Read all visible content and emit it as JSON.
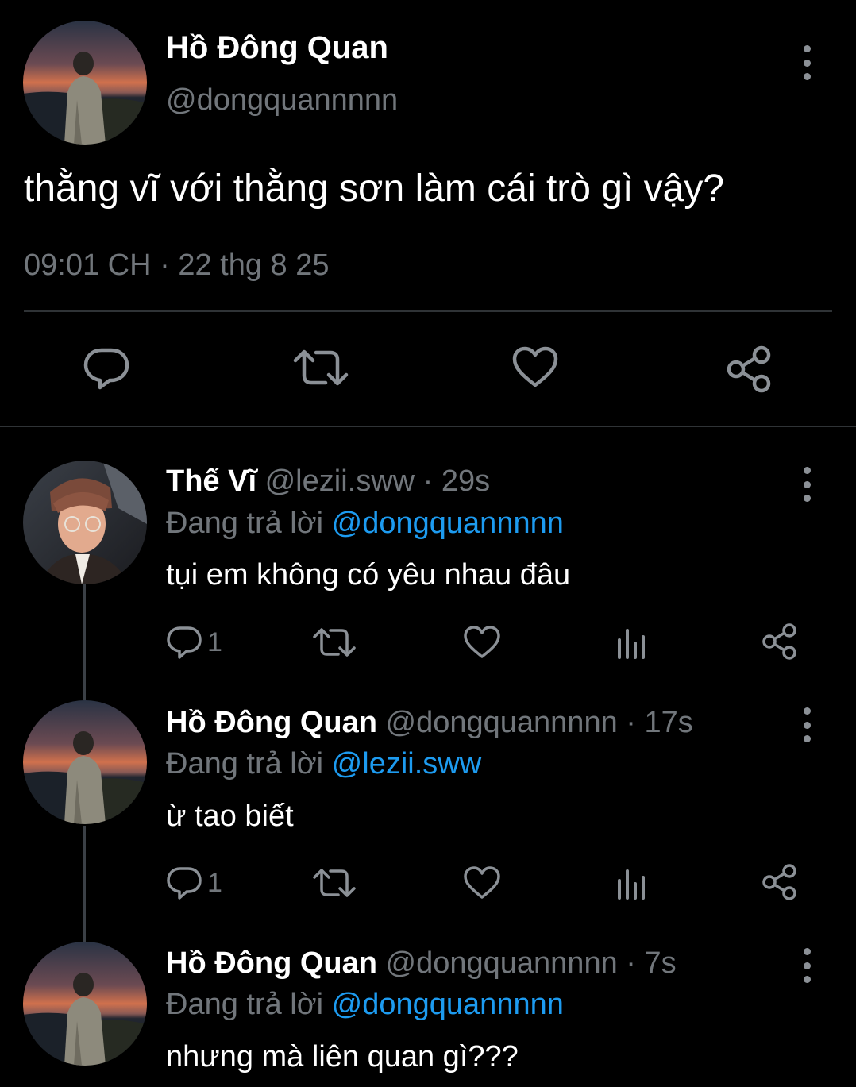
{
  "colors": {
    "background": "#000000",
    "primary_text": "#ffffff",
    "secondary_text": "#71767b",
    "mention": "#1d9bf0",
    "divider": "#2f3336"
  },
  "main_tweet": {
    "display_name": "Hồ Đông Quan",
    "handle": "@dongquannnnn",
    "text": "thằng vĩ với thằng sơn làm cái trò gì vậy?",
    "time": "09:01 CH",
    "separator": "·",
    "date": "22 thg 8 25",
    "actions": [
      "reply-icon",
      "retweet-icon",
      "like-icon",
      "share-icon"
    ]
  },
  "replies": [
    {
      "display_name": "Thế Vĩ",
      "handle": "@lezii.sww",
      "separator": "·",
      "age": "29s",
      "reply_prefix": "Đang trả lời",
      "reply_to": "@dongquannnnn",
      "text": "tụi em không có yêu nhau đâu",
      "reply_count": "1"
    },
    {
      "display_name": "Hồ Đông Quan",
      "handle": "@dongquannnnn",
      "separator": "·",
      "age": "17s",
      "reply_prefix": "Đang trả lời",
      "reply_to": "@lezii.sww",
      "text": "ừ tao biết",
      "reply_count": "1"
    },
    {
      "display_name": "Hồ Đông Quan",
      "handle": "@dongquannnnn",
      "separator": "·",
      "age": "7s",
      "reply_prefix": "Đang trả lời",
      "reply_to": "@dongquannnnn",
      "text": "nhưng mà liên quan gì???"
    }
  ]
}
